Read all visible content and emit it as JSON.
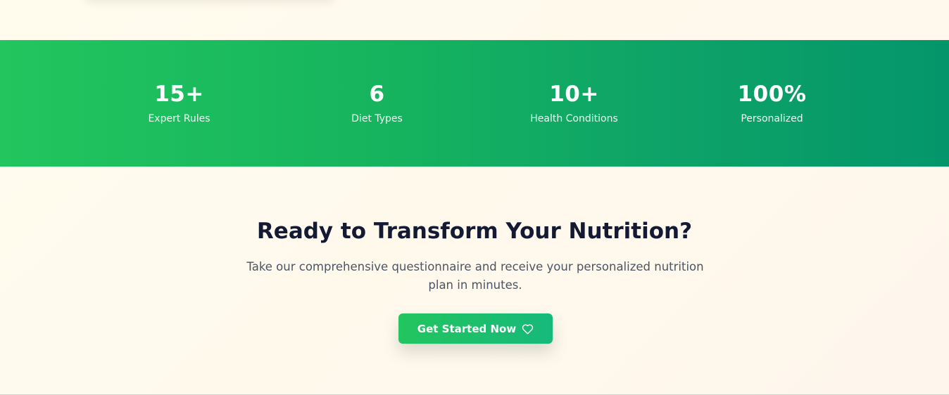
{
  "stats": [
    {
      "value": "15+",
      "label": "Expert Rules"
    },
    {
      "value": "6",
      "label": "Diet Types"
    },
    {
      "value": "10+",
      "label": "Health Conditions"
    },
    {
      "value": "100%",
      "label": "Personalized"
    }
  ],
  "cta": {
    "title": "Ready to Transform Your Nutrition?",
    "subtitle": "Take our comprehensive questionnaire and receive your personalized nutrition plan in minutes.",
    "button_label": "Get Started Now",
    "button_icon": "heart-icon"
  },
  "colors": {
    "band_start": "#22c55e",
    "band_end": "#04966a",
    "title": "#141a33",
    "subtitle": "#4b5563"
  }
}
